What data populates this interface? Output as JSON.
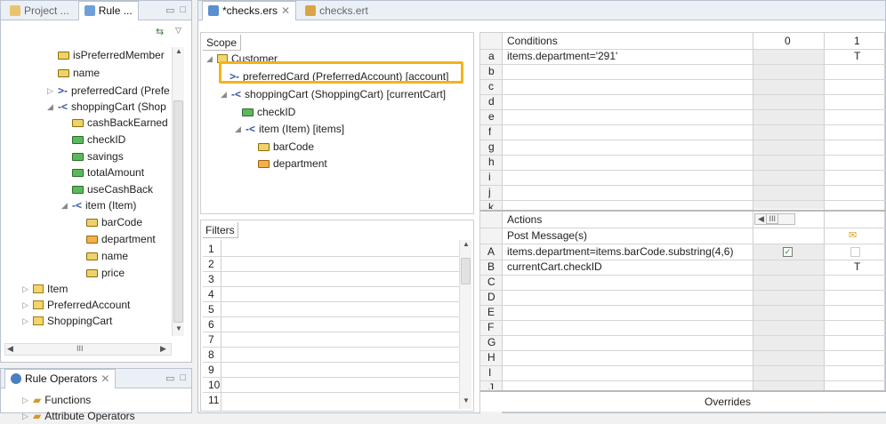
{
  "left_panel": {
    "tabs": [
      {
        "label": "Project ..."
      },
      {
        "label": "Rule ..."
      }
    ],
    "tree": [
      {
        "label": "isPreferredMember"
      },
      {
        "label": "name"
      },
      {
        "label": "preferredCard (Prefe"
      },
      {
        "label": "shoppingCart (Shop"
      },
      {
        "label": "cashBackEarned"
      },
      {
        "label": "checkID"
      },
      {
        "label": "savings"
      },
      {
        "label": "totalAmount"
      },
      {
        "label": "useCashBack"
      },
      {
        "label": "item (Item)"
      },
      {
        "label": "barCode"
      },
      {
        "label": "department"
      },
      {
        "label": "name"
      },
      {
        "label": "price"
      },
      {
        "label": "Item"
      },
      {
        "label": "PreferredAccount"
      },
      {
        "label": "ShoppingCart"
      }
    ],
    "hscroll": "III"
  },
  "operators_panel": {
    "title": "Rule Operators",
    "items": [
      {
        "label": "Functions"
      },
      {
        "label": "Attribute Operators"
      }
    ]
  },
  "editor": {
    "tabs": [
      {
        "label": "*checks.ers"
      },
      {
        "label": "checks.ert"
      }
    ],
    "scope": {
      "header": "Scope",
      "items": [
        {
          "label": "Customer"
        },
        {
          "label": "preferredCard (PreferredAccount) [account]"
        },
        {
          "label": "shoppingCart (ShoppingCart) [currentCart]"
        },
        {
          "label": "checkID"
        },
        {
          "label": "item (Item) [items]"
        },
        {
          "label": "barCode"
        },
        {
          "label": "department"
        }
      ]
    },
    "filters": {
      "header": "Filters",
      "rows": [
        "1",
        "2",
        "3",
        "4",
        "5",
        "6",
        "7",
        "8",
        "9",
        "10",
        "11"
      ]
    },
    "conditions": {
      "header": "Conditions",
      "col0": "0",
      "col1": "1",
      "rows": [
        {
          "key": "a",
          "text": "items.department='291'",
          "v1": "T"
        },
        {
          "key": "b",
          "text": "",
          "v1": ""
        },
        {
          "key": "c",
          "text": "",
          "v1": ""
        },
        {
          "key": "d",
          "text": "",
          "v1": ""
        },
        {
          "key": "e",
          "text": "",
          "v1": ""
        },
        {
          "key": "f",
          "text": "",
          "v1": ""
        },
        {
          "key": "g",
          "text": "",
          "v1": ""
        },
        {
          "key": "h",
          "text": "",
          "v1": ""
        },
        {
          "key": "i",
          "text": "",
          "v1": ""
        },
        {
          "key": "j",
          "text": "",
          "v1": ""
        },
        {
          "key": "k",
          "text": "",
          "v1": ""
        }
      ]
    },
    "actions": {
      "header": "Actions",
      "post_message": "Post Message(s)",
      "scroll_label": "III",
      "rows": [
        {
          "key": "A",
          "text": "items.department=items.barCode.substring(4,6)",
          "v1": ""
        },
        {
          "key": "B",
          "text": "currentCart.checkID",
          "v1": "T"
        },
        {
          "key": "C",
          "text": "",
          "v1": ""
        },
        {
          "key": "D",
          "text": "",
          "v1": ""
        },
        {
          "key": "E",
          "text": "",
          "v1": ""
        },
        {
          "key": "F",
          "text": "",
          "v1": ""
        },
        {
          "key": "G",
          "text": "",
          "v1": ""
        },
        {
          "key": "H",
          "text": "",
          "v1": ""
        },
        {
          "key": "I",
          "text": "",
          "v1": ""
        },
        {
          "key": "J",
          "text": "",
          "v1": ""
        }
      ]
    },
    "overrides": "Overrides"
  },
  "colors": {
    "highlight": "#f3b31a",
    "accent_blue": "#3a56a8"
  }
}
